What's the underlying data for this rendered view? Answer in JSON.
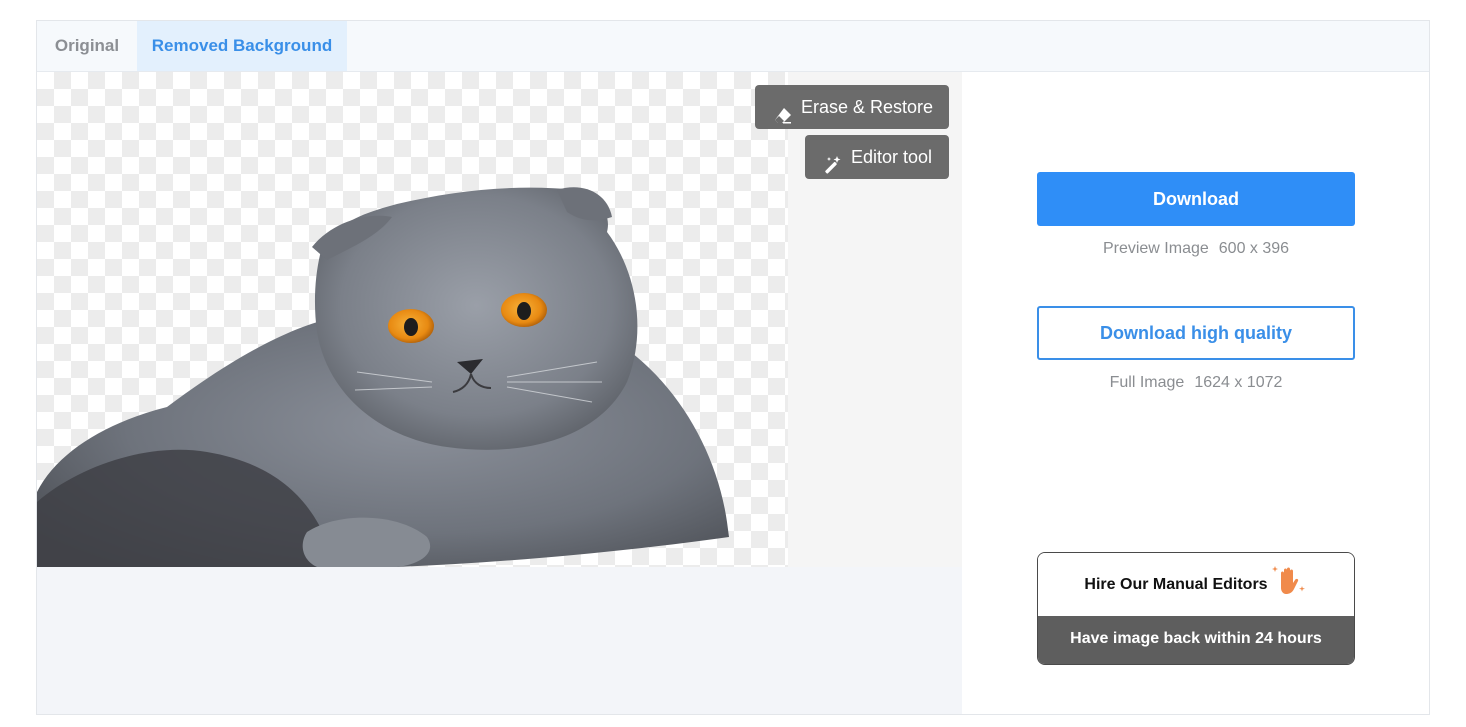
{
  "tabs": {
    "original": "Original",
    "removed": "Removed Background"
  },
  "tools": {
    "erase_restore": "Erase & Restore",
    "editor_tool": "Editor tool"
  },
  "download": {
    "label": "Download",
    "preview_label": "Preview Image",
    "preview_size": "600 x 396"
  },
  "download_hq": {
    "label": "Download high quality",
    "full_label": "Full Image",
    "full_size": "1624 x 1072"
  },
  "hire": {
    "title": "Hire Our Manual Editors",
    "subtitle": "Have image back within 24 hours"
  },
  "colors": {
    "accent": "#2f8ef7",
    "tab_active_bg": "#e3f0fd",
    "tool_button": "#6b6b6b",
    "hire_band": "#5e5e5e",
    "hand_icon": "#f08a4b"
  },
  "icons": {
    "erase": "eraser-icon",
    "editor": "magic-wand-icon",
    "hire": "waving-hand-icon"
  }
}
